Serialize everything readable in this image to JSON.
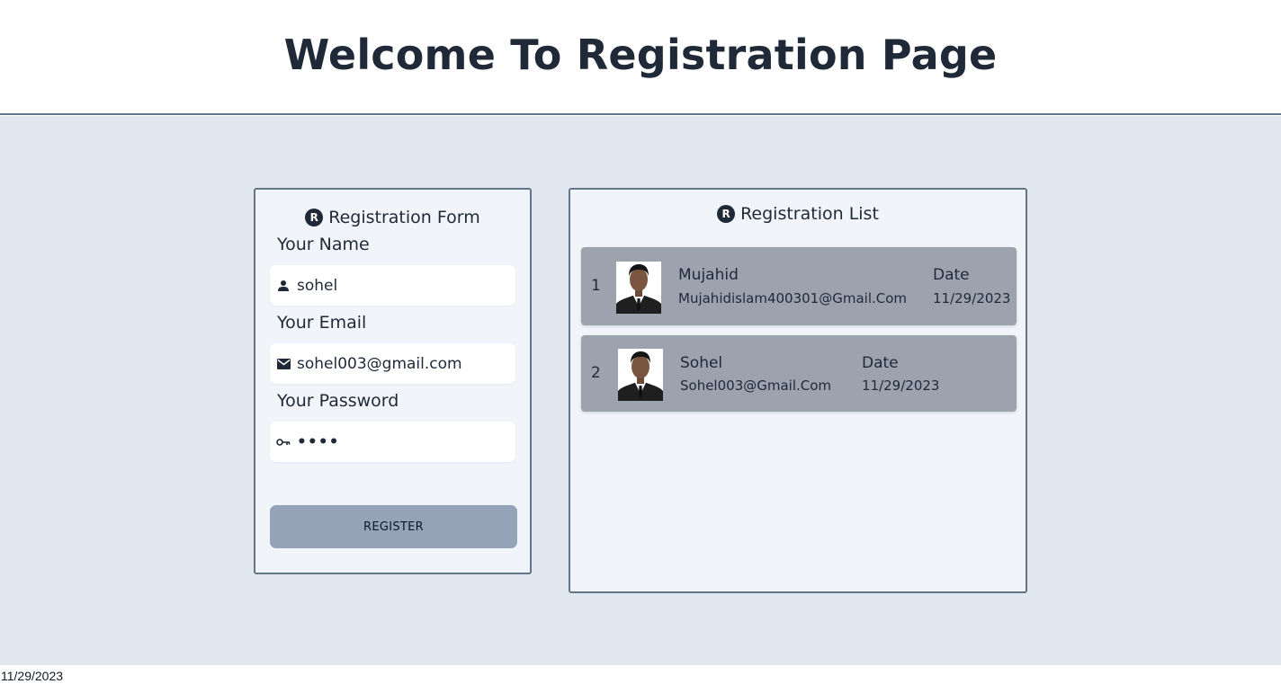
{
  "header": {
    "title": "Welcome To Registration Page"
  },
  "form": {
    "title": "Registration Form",
    "title_icon": "registered-icon",
    "name_label": "Your Name",
    "name_value": "sohel",
    "email_label": "Your Email",
    "email_value": "sohel003@gmail.com",
    "password_label": "Your Password",
    "password_value": "••••",
    "register_label": "REGISTER"
  },
  "list": {
    "title": "Registration List",
    "title_icon": "registered-icon",
    "items": [
      {
        "num": "1",
        "name": "Mujahid",
        "email": "Mujahidislam400301@Gmail.Com",
        "date_label": "Date",
        "date": "11/29/2023"
      },
      {
        "num": "2",
        "name": "Sohel",
        "email": "Sohel003@Gmail.Com",
        "date_label": "Date",
        "date": "11/29/2023"
      }
    ]
  },
  "footer": {
    "date": "11/29/2023"
  },
  "colors": {
    "page_bg": "#e2e8f0",
    "panel_bg": "#f1f5f9",
    "row_bg": "#9ca3af",
    "button_bg": "#94a3b8",
    "border": "#64748b"
  }
}
